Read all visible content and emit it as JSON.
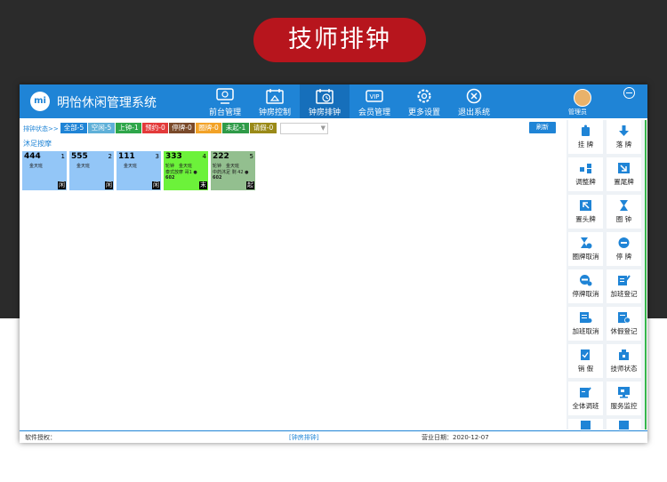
{
  "banner": {
    "title": "技师排钟"
  },
  "app": {
    "title": "明怡休闲管理系统",
    "logo_text": "mi",
    "user": "管理员"
  },
  "nav": [
    {
      "label": "前台管理",
      "icon": "monitor-icon"
    },
    {
      "label": "钟房控制",
      "icon": "calendar-home-icon"
    },
    {
      "label": "钟房排钟",
      "icon": "calendar-clock-icon"
    },
    {
      "label": "会员管理",
      "icon": "vip-card-icon"
    },
    {
      "label": "更多设置",
      "icon": "gear-icon"
    },
    {
      "label": "退出系统",
      "icon": "close-circle-icon"
    }
  ],
  "active_nav": "钟房排钟",
  "breadcrumb": "排钟状态>>",
  "filters": [
    {
      "label": "全部-5",
      "color": "#1f84d6"
    },
    {
      "label": "空闲-5",
      "color": "#5fb0d8"
    },
    {
      "label": "上钟-1",
      "color": "#2ea64a"
    },
    {
      "label": "预约-0",
      "color": "#e33a3a"
    },
    {
      "label": "停牌-0",
      "color": "#7a4a2a"
    },
    {
      "label": "圈牌-0",
      "color": "#f2a227"
    },
    {
      "label": "未起-1",
      "color": "#2f9b48"
    },
    {
      "label": "请假-0",
      "color": "#9a8a18"
    }
  ],
  "refresh_label": "刷新",
  "section_title": "沐足按摩",
  "cards": [
    {
      "number": "444",
      "index": "1",
      "lines": [
        "金天班"
      ],
      "status": "闲",
      "color": "#93c6f7"
    },
    {
      "number": "555",
      "index": "2",
      "lines": [
        "金天班"
      ],
      "status": "闲",
      "color": "#93c6f7"
    },
    {
      "number": "111",
      "index": "3",
      "lines": [
        "金天班"
      ],
      "status": "闲",
      "color": "#93c6f7"
    },
    {
      "number": "333",
      "index": "4",
      "lines": [
        "轮钟　金天班",
        "泰式放摩 哥1 ●",
        "602"
      ],
      "status": "末",
      "color": "#6cf23a"
    },
    {
      "number": "222",
      "index": "5",
      "lines": [
        "轮钟　金天班",
        "中药沐足 剩 42 ●",
        "602"
      ],
      "status": "起",
      "color": "#93bf8f"
    }
  ],
  "side_buttons": [
    {
      "label": "挂 牌",
      "icon": "tag-icon"
    },
    {
      "label": "落 牌",
      "icon": "arrow-down-icon"
    },
    {
      "label": "调整牌",
      "icon": "adjust-icon"
    },
    {
      "label": "置尾牌",
      "icon": "arrow-bottom-right-icon"
    },
    {
      "label": "置头牌",
      "icon": "arrow-top-left-icon"
    },
    {
      "label": "圈 钟",
      "icon": "hourglass-icon"
    },
    {
      "label": "圈牌取消",
      "icon": "hourglass-cancel-icon"
    },
    {
      "label": "停 牌",
      "icon": "stop-circle-icon"
    },
    {
      "label": "停牌取消",
      "icon": "stop-cancel-icon"
    },
    {
      "label": "加班登记",
      "icon": "edit-note-icon"
    },
    {
      "label": "加班取消",
      "icon": "note-cancel-icon"
    },
    {
      "label": "休假登记",
      "icon": "calendar-note-icon"
    },
    {
      "label": "销 假",
      "icon": "doc-check-icon"
    },
    {
      "label": "技师状态",
      "icon": "tech-status-icon"
    },
    {
      "label": "全体调班",
      "icon": "edit-all-icon"
    },
    {
      "label": "服务监控",
      "icon": "monitor-service-icon"
    }
  ],
  "status_bar": {
    "license": "软件授权：",
    "module": "[钟房排钟]",
    "date": "营业日期：2020-12-07"
  }
}
